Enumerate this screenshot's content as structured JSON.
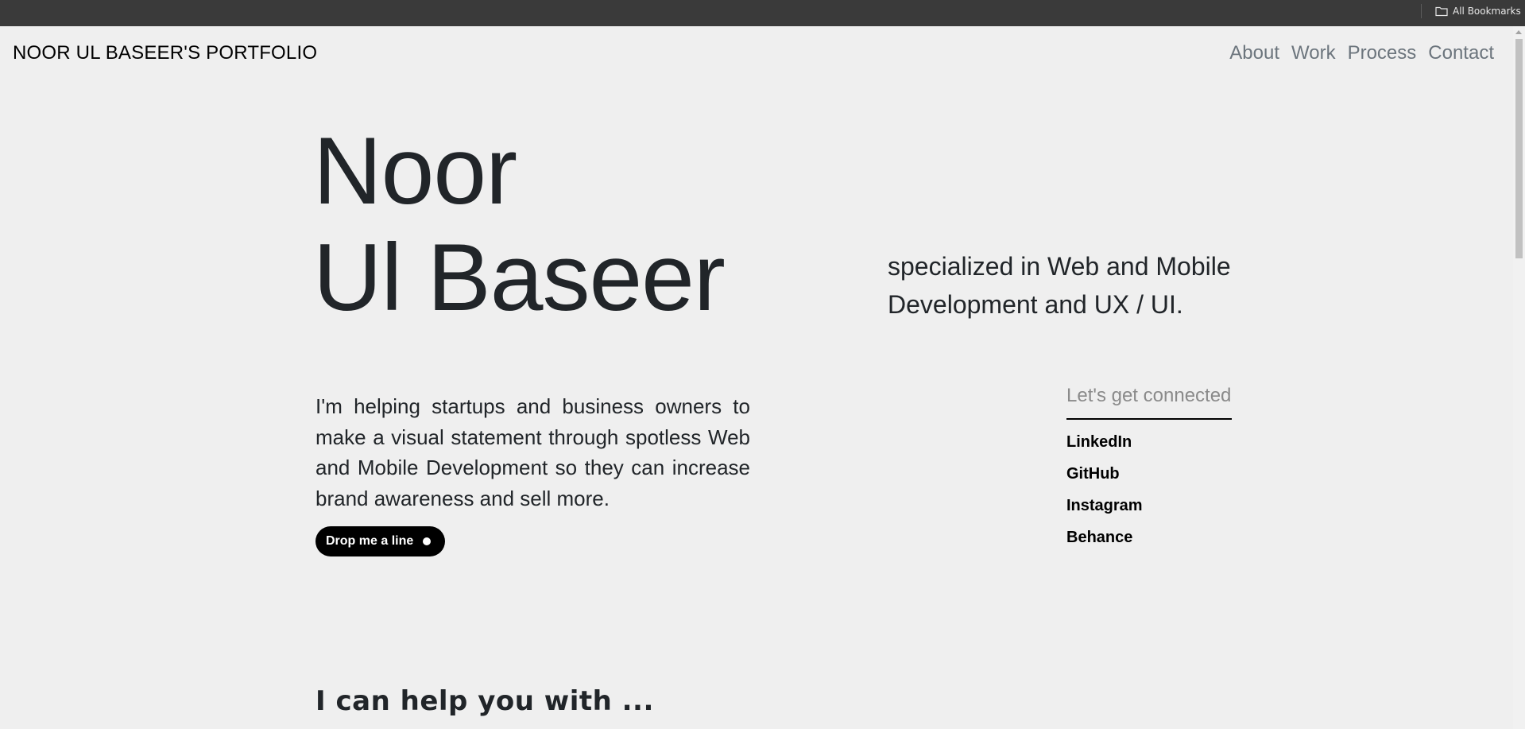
{
  "browser": {
    "bookmarks_label": "All Bookmarks"
  },
  "header": {
    "brand": "NOOR UL BASEER'S PORTFOLIO",
    "nav": [
      "About",
      "Work",
      "Process",
      "Contact"
    ]
  },
  "hero": {
    "name_line1": "Noor",
    "name_line2": "Ul Baseer",
    "specialized": "specialized in Web and Mobile Development and UX / UI.",
    "intro": "I'm helping startups and business owners to make a visual statement through spotless Web and Mobile Development so they can increase brand awareness and sell more.",
    "cta_label": "Drop me a line"
  },
  "connect": {
    "heading": "Let's get connected",
    "links": [
      "LinkedIn",
      "GitHub",
      "Instagram",
      "Behance"
    ]
  },
  "services": {
    "heading": "I can help you with ..."
  },
  "colors": {
    "page_background": "#efefef",
    "bookmarks_bar": "#3a3a3a",
    "text_dark": "#212529",
    "nav_text": "#6c757d",
    "cta_background": "#000000"
  },
  "icons": {
    "bookmarks": "folder-icon",
    "cta": "dot-icon"
  }
}
